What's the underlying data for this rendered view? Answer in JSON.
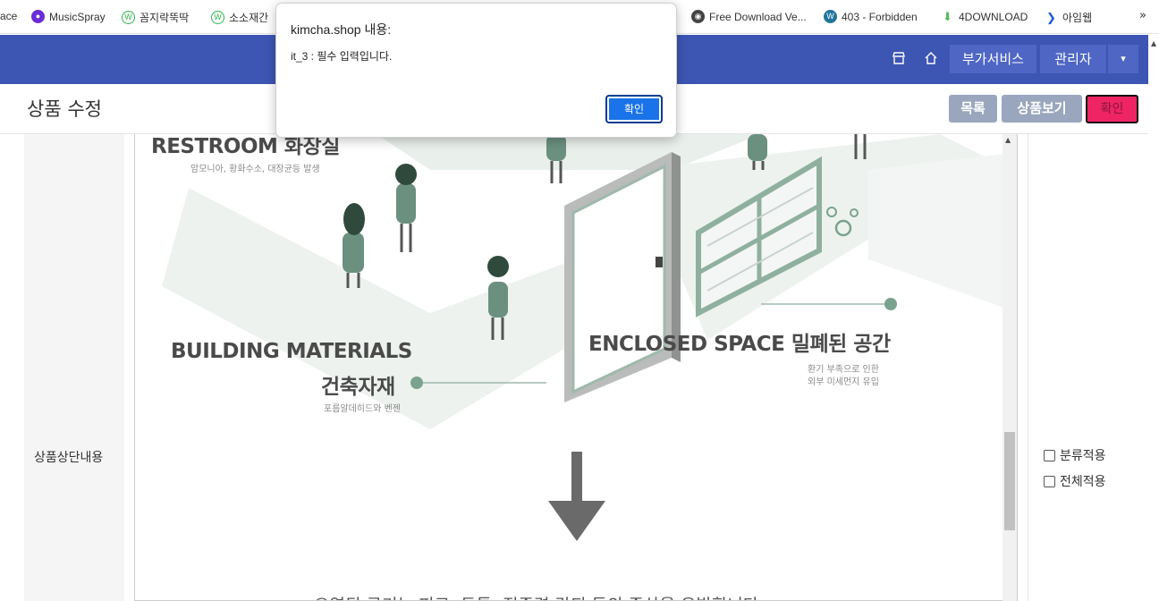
{
  "bookmarks": {
    "items": [
      {
        "label": "ace"
      },
      {
        "label": "MusicSpray"
      },
      {
        "label": "꼼지락뚝딱"
      },
      {
        "label": "소소재간"
      },
      {
        "label": "Free Download Ve..."
      },
      {
        "label": "403 - Forbidden"
      },
      {
        "label": "4DOWNLOAD"
      },
      {
        "label": "아임웹"
      }
    ],
    "more": "»"
  },
  "header": {
    "addon_label": "부가서비스",
    "admin_label": "관리자",
    "caret": "▾"
  },
  "page": {
    "title": "상품 수정",
    "list_button": "목록",
    "view_button": "상품보기",
    "confirm_button": "확인"
  },
  "form": {
    "field_label": "상품상단내용",
    "checkboxes": [
      {
        "label": "분류적용",
        "checked": false
      },
      {
        "label": "전체적용",
        "checked": false
      }
    ]
  },
  "illustration": {
    "restroom": "RESTROOM 화장실",
    "restroom_sub": "암모니아, 황화수소, 대장균등 발생",
    "building": "BUILDING MATERIALS",
    "building_kr": "건축자재",
    "building_sub": "포름알데히드와 벤젠",
    "enclosed": "ENCLOSED SPACE 밀폐된 공간",
    "enclosed_sub1": "환기 부족으로 인한",
    "enclosed_sub2": "외부 미세먼지 유입",
    "bottom_text": "오염된 공기는 피로, 두통, 집중력 감퇴 등의 증상을 유발합니다."
  },
  "dialog": {
    "title": "kimcha.shop 내용:",
    "message": "it_3 : 필수 입력입니다.",
    "ok_label": "확인"
  },
  "colors": {
    "header_bg": "#3d55b3",
    "confirm_bg": "#ee2465",
    "dialog_ok_bg": "#1a73e8",
    "illustration_green": "#7aa38d"
  }
}
